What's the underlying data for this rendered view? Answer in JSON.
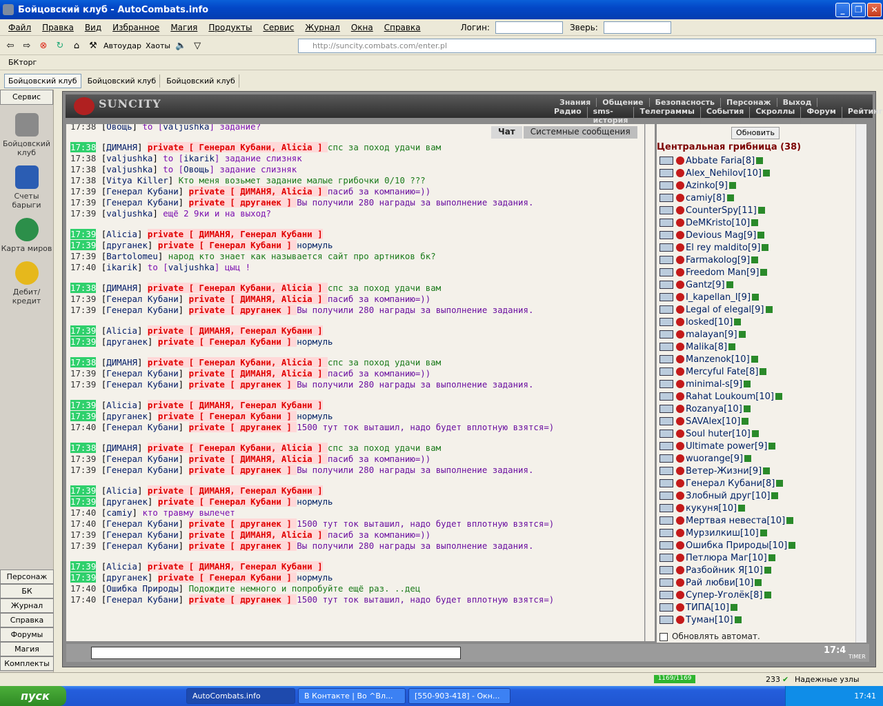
{
  "window": {
    "title": "Бойцовский клуб - AutoCombats.info"
  },
  "menu": {
    "items": [
      "Файл",
      "Правка",
      "Вид",
      "Избранное",
      "Магия",
      "Продукты",
      "Сервис",
      "Журнал",
      "Окна",
      "Справка"
    ],
    "login_label": "Логин:",
    "beast_label": "Зверь:"
  },
  "toolbar": {
    "autoudar": "Автоудар",
    "haoty": "Хаоты",
    "address": "http://suncity.combats.com/enter.pl"
  },
  "favorites": {
    "item": "БКторг"
  },
  "tabs": [
    "Бойцовский клуб",
    "Бойцовский клуб",
    "Бойцовский клуб"
  ],
  "sidebar": {
    "header": "Сервис",
    "big": [
      "Бойцовский клуб",
      "Счеты барыги",
      "Карта миров",
      "Дебит/кредит"
    ],
    "buttons": [
      "Персонаж",
      "БК",
      "Журнал",
      "Справка",
      "Форумы",
      "Магия",
      "Комплекты"
    ]
  },
  "game": {
    "logo": "SUNCITY",
    "nav_top": [
      "Знания",
      "Общение",
      "Безопасность",
      "Персонаж",
      "Выход"
    ],
    "nav_bottom": [
      "Радио",
      "sms-история",
      "Телеграммы",
      "События",
      "Скроллы",
      "Форум",
      "Рейтинг"
    ],
    "chat_tabs": [
      "Чат",
      "Системные сообщения"
    ],
    "refresh": "Обновить",
    "room": "Центральная грибница (38)",
    "autoupdate": "Обновлять автомат.",
    "clock": "17:4",
    "timer_label": "TIMER"
  },
  "chat": [
    {
      "t": "17:38",
      "hl": false,
      "n": "Овощь",
      "k": "to",
      "tg": "valjushka",
      "m": "задание?"
    },
    {
      "gap": true
    },
    {
      "t": "17:38",
      "hl": true,
      "n": "ДИМАНЯ",
      "k": "pv",
      "tg": "Генерал Кубани, Alicia",
      "m": "спс за поход удачи вам"
    },
    {
      "t": "17:38",
      "hl": false,
      "n": "valjushka",
      "k": "to",
      "tg": "ikarik",
      "m": "задание слизняк"
    },
    {
      "t": "17:38",
      "hl": false,
      "n": "valjushka",
      "k": "to",
      "tg": "Овощь",
      "m": "задание слизняк"
    },
    {
      "t": "17:38",
      "hl": false,
      "n": "Vitya Killer",
      "k": "say",
      "m": "Кто меня возьмет задание малые грибочки 0/10 ???"
    },
    {
      "t": "17:39",
      "hl": false,
      "n": "Генерал Кубани",
      "k": "pv",
      "tg": "ДИМАНЯ, Alicia",
      "m": "пасиб за компанию=))"
    },
    {
      "t": "17:39",
      "hl": false,
      "n": "Генерал Кубани",
      "k": "pv",
      "tg": "друганек",
      "m": "Вы получили 280 награды за выполнение задания."
    },
    {
      "t": "17:39",
      "hl": false,
      "n": "valjushka",
      "k": "say2",
      "m": "ещё 2 9ки и на выход?"
    },
    {
      "gap": true
    },
    {
      "t": "17:39",
      "hl": true,
      "n": "Alicia",
      "k": "pv2",
      "tg": "ДИМАНЯ, Генерал Кубани",
      "m": ""
    },
    {
      "t": "17:39",
      "hl": true,
      "n": "друганек",
      "k": "pv",
      "tg": "Генерал Кубани",
      "m": "нормуль"
    },
    {
      "t": "17:39",
      "hl": false,
      "n": "Bartolomeu",
      "k": "say",
      "m": "народ кто знает как называется сайт про артников бк?"
    },
    {
      "t": "17:40",
      "hl": false,
      "n": "ikarik",
      "k": "to",
      "tg": "valjushka",
      "m": "цыц !"
    },
    {
      "gap": true
    },
    {
      "t": "17:38",
      "hl": true,
      "n": "ДИМАНЯ",
      "k": "pv",
      "tg": "Генерал Кубани, Alicia",
      "m": "спс за поход удачи вам"
    },
    {
      "t": "17:39",
      "hl": false,
      "n": "Генерал Кубани",
      "k": "pv",
      "tg": "ДИМАНЯ, Alicia",
      "m": "пасиб за компанию=))"
    },
    {
      "t": "17:39",
      "hl": false,
      "n": "Генерал Кубани",
      "k": "pv",
      "tg": "друганек",
      "m": "Вы получили 280 награды за выполнение задания."
    },
    {
      "gap": true
    },
    {
      "t": "17:39",
      "hl": true,
      "n": "Alicia",
      "k": "pv2",
      "tg": "ДИМАНЯ, Генерал Кубани",
      "m": ""
    },
    {
      "t": "17:39",
      "hl": true,
      "n": "друганек",
      "k": "pv",
      "tg": "Генерал Кубани",
      "m": "нормуль"
    },
    {
      "gap": true
    },
    {
      "t": "17:38",
      "hl": true,
      "n": "ДИМАНЯ",
      "k": "pv",
      "tg": "Генерал Кубани, Alicia",
      "m": "спс за поход удачи вам"
    },
    {
      "t": "17:39",
      "hl": false,
      "n": "Генерал Кубани",
      "k": "pv",
      "tg": "ДИМАНЯ, Alicia",
      "m": "пасиб за компанию=))"
    },
    {
      "t": "17:39",
      "hl": false,
      "n": "Генерал Кубани",
      "k": "pv",
      "tg": "друганек",
      "m": "Вы получили 280 награды за выполнение задания."
    },
    {
      "gap": true
    },
    {
      "t": "17:39",
      "hl": true,
      "n": "Alicia",
      "k": "pv2",
      "tg": "ДИМАНЯ, Генерал Кубани",
      "m": ""
    },
    {
      "t": "17:39",
      "hl": true,
      "n": "друганек",
      "k": "pv",
      "tg": "Генерал Кубани",
      "m": "нормуль"
    },
    {
      "t": "17:40",
      "hl": false,
      "n": "Генерал Кубани",
      "k": "pv",
      "tg": "друганек",
      "m": "1500 тут ток выташил, надо будет вплотную взятся=)"
    },
    {
      "gap": true
    },
    {
      "t": "17:38",
      "hl": true,
      "n": "ДИМАНЯ",
      "k": "pv",
      "tg": "Генерал Кубани, Alicia",
      "m": "спс за поход удачи вам"
    },
    {
      "t": "17:39",
      "hl": false,
      "n": "Генерал Кубани",
      "k": "pv",
      "tg": "ДИМАНЯ, Alicia",
      "m": "пасиб за компанию=))"
    },
    {
      "t": "17:39",
      "hl": false,
      "n": "Генерал Кубани",
      "k": "pv",
      "tg": "друганек",
      "m": "Вы получили 280 награды за выполнение задания."
    },
    {
      "gap": true
    },
    {
      "t": "17:39",
      "hl": true,
      "n": "Alicia",
      "k": "pv2",
      "tg": "ДИМАНЯ, Генерал Кубани",
      "m": ""
    },
    {
      "t": "17:39",
      "hl": true,
      "n": "друганек",
      "k": "pv",
      "tg": "Генерал Кубани",
      "m": "нормуль"
    },
    {
      "t": "17:40",
      "hl": false,
      "n": "camiy",
      "k": "say2",
      "m": "кто травму вылечет"
    },
    {
      "t": "17:40",
      "hl": false,
      "n": "Генерал Кубани",
      "k": "pv",
      "tg": "друганек",
      "m": "1500 тут ток выташил, надо будет вплотную взятся=)"
    },
    {
      "t": "17:39",
      "hl": false,
      "n": "Генерал Кубани",
      "k": "pv",
      "tg": "ДИМАНЯ, Alicia",
      "m": "пасиб за компанию=))"
    },
    {
      "t": "17:39",
      "hl": false,
      "n": "Генерал Кубани",
      "k": "pv",
      "tg": "друганек",
      "m": "Вы получили 280 награды за выполнение задания."
    },
    {
      "gap": true
    },
    {
      "t": "17:39",
      "hl": true,
      "n": "Alicia",
      "k": "pv2",
      "tg": "ДИМАНЯ, Генерал Кубани",
      "m": ""
    },
    {
      "t": "17:39",
      "hl": true,
      "n": "друганек",
      "k": "pv",
      "tg": "Генерал Кубани",
      "m": "нормуль"
    },
    {
      "t": "17:40",
      "hl": false,
      "n": "Ошибка Природы",
      "k": "say",
      "m": "Подождите немного и попробуйте ещё раз. ..дец"
    },
    {
      "t": "17:40",
      "hl": false,
      "n": "Генерал Кубани",
      "k": "pv",
      "tg": "друганек",
      "m": "1500 тут ток выташил, надо будет вплотную взятся=)"
    }
  ],
  "users": [
    "Abbate Faria[8]",
    "Alex_Nehilov[10]",
    "Azinko[9]",
    "camiy[8]",
    "CounterSpy[11]",
    "DeMKristo[10]",
    "Devious Mag[9]",
    "El rey maldito[9]",
    "Farmakolog[9]",
    "Freedom Man[9]",
    "Gantz[9]",
    "I_kapellan_I[9]",
    "Legal of elegal[9]",
    "losked[10]",
    "malayan[9]",
    "Malika[8]",
    "Manzenok[10]",
    "Mercyful Fate[8]",
    "minimal-s[9]",
    "Rahat Loukoum[10]",
    "Rozanya[10]",
    "SAVAlex[10]",
    "Soul huter[10]",
    "Ultimate power[9]",
    "wuorange[9]",
    "Ветер-Жизни[9]",
    "Генерал Кубани[8]",
    "Злобный друг[10]",
    "кукуня[10]",
    "Мертвая невеста[10]",
    "Мурзилкиш[10]",
    "Ошибка Природы[10]",
    "Петлюра Маг[10]",
    "Разбойник Я[10]",
    "Рай любви[10]",
    "Супер-Уголёк[8]",
    "ТИПА[10]",
    "Туман[10]"
  ],
  "status": {
    "progress": "1169/1169",
    "count": "233",
    "zone": "Надежные узлы"
  },
  "taskbar": {
    "start": "пуск",
    "tasks": [
      "AutoCombats.info",
      "В Контакте | Во ^Вл...",
      "[550-903-418] - Окн..."
    ],
    "time": "17:41"
  }
}
